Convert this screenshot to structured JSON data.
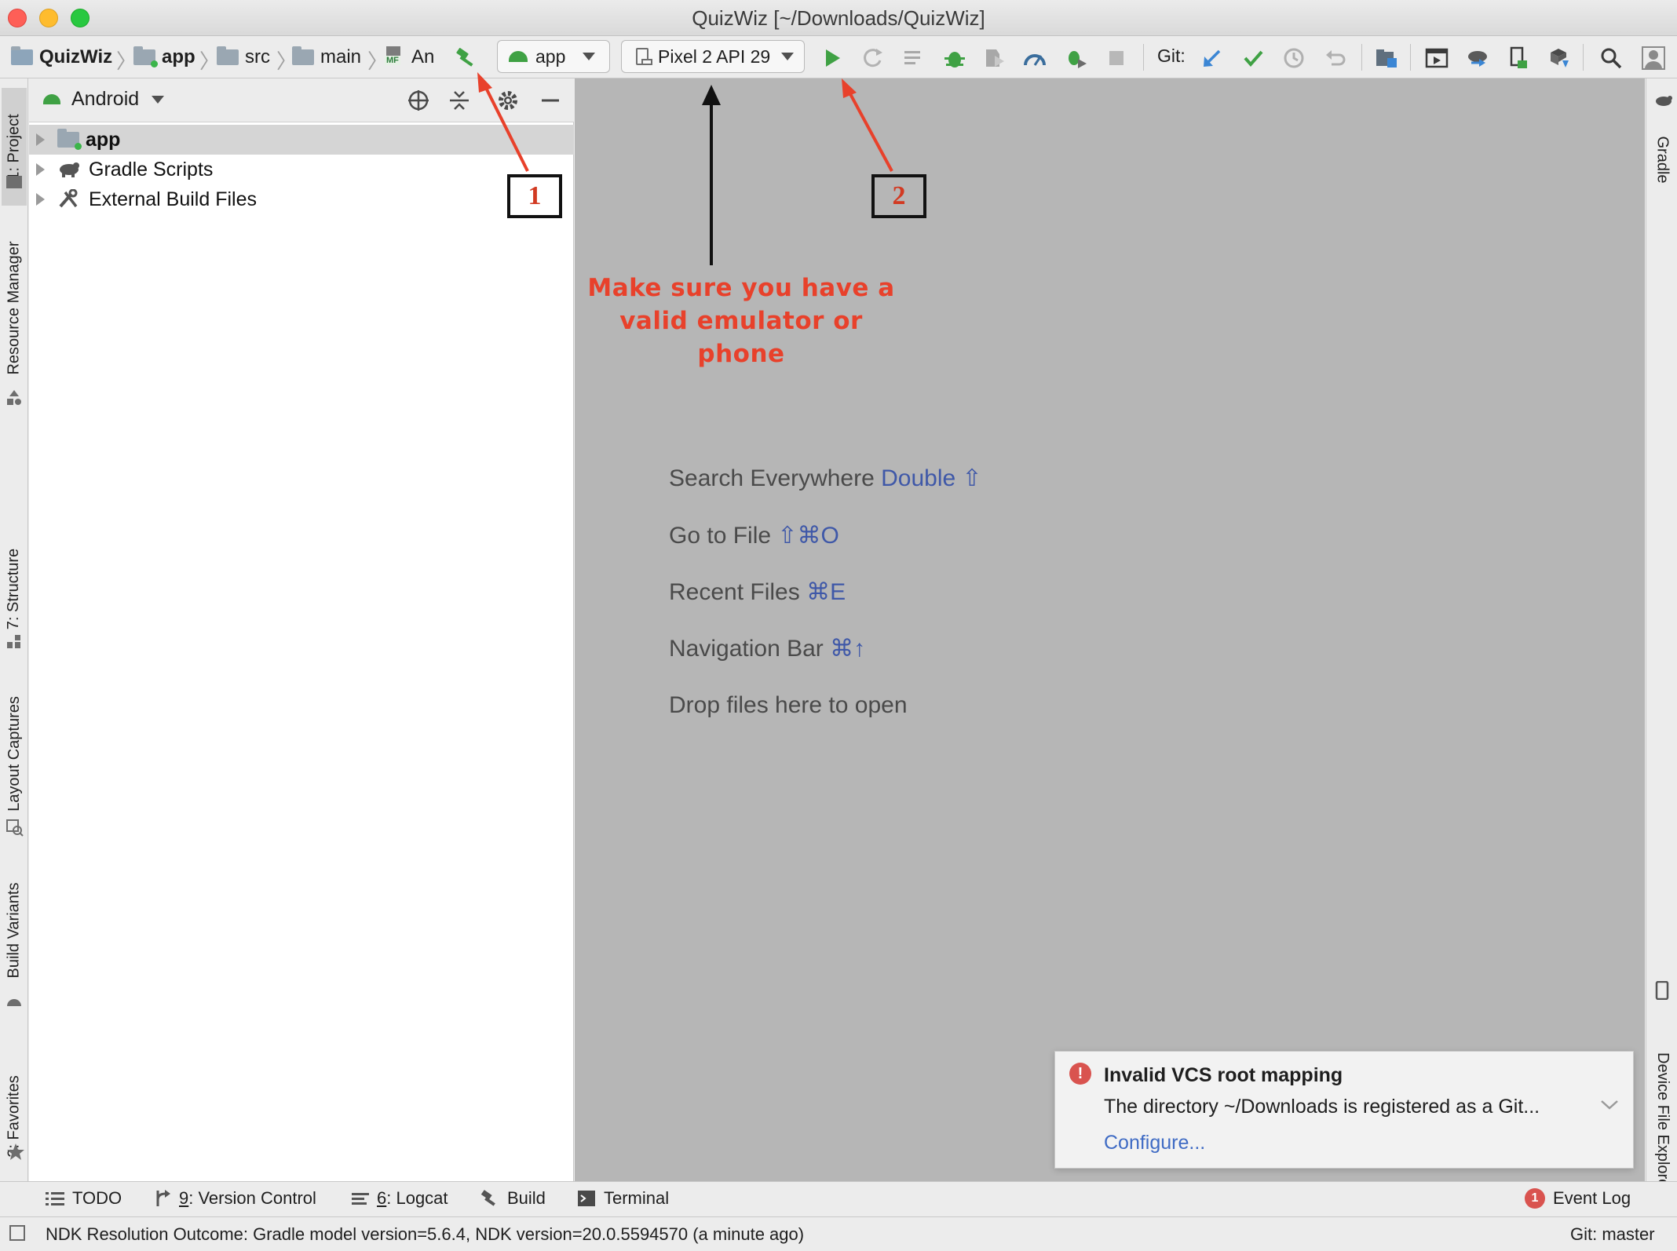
{
  "window": {
    "title": "QuizWiz [~/Downloads/QuizWiz]"
  },
  "breadcrumbs": {
    "project": "QuizWiz",
    "module": "app",
    "src": "src",
    "main": "main",
    "manifest": "An",
    "manifest_badge": "MF"
  },
  "toolbar": {
    "run_config": "app",
    "device": "Pixel 2 API 29",
    "git_label": "Git:"
  },
  "left_tabs": {
    "project": "1: Project",
    "resource_manager": "Resource Manager",
    "structure": "7: Structure",
    "layout_captures": "Layout Captures",
    "build_variants": "Build Variants",
    "favorites": "2: Favorites"
  },
  "right_tabs": {
    "gradle": "Gradle",
    "device_file_explorer": "Device File Explorer"
  },
  "project_panel": {
    "view_mode": "Android",
    "items": [
      {
        "label": "app"
      },
      {
        "label": "Gradle Scripts"
      },
      {
        "label": "External Build Files"
      }
    ]
  },
  "editor_hints": {
    "search": {
      "label": "Search Everywhere",
      "key": "Double ⇧"
    },
    "goto_file": {
      "label": "Go to File",
      "key": "⇧⌘O"
    },
    "recent_files": {
      "label": "Recent Files",
      "key": "⌘E"
    },
    "navigation_bar": {
      "label": "Navigation Bar",
      "key": "⌘↑"
    },
    "drop_files": {
      "label": "Drop files here to open"
    }
  },
  "annotations": {
    "callout_1": "1",
    "callout_2": "2",
    "note_line1": "Make sure you have a",
    "note_line2": "valid emulator or",
    "note_line3": "phone"
  },
  "notification": {
    "title": "Invalid VCS root mapping",
    "body": "The directory ~/Downloads is registered as a Git...",
    "action": "Configure..."
  },
  "bottom_tabs": {
    "todo": "TODO",
    "version_control_num": "9",
    "version_control": ": Version Control",
    "logcat_num": "6",
    "logcat": ": Logcat",
    "build": "Build",
    "terminal": "Terminal",
    "event_log": "Event Log",
    "event_log_count": "1"
  },
  "status_bar": {
    "message": "NDK Resolution Outcome: Gradle model version=5.6.4, NDK version=20.0.5594570 (a minute ago)",
    "git_branch": "Git: master"
  },
  "colors": {
    "annotation_red": "#e8412b",
    "run_green": "#3fa144",
    "link_blue": "#3f58a8",
    "editor_bg": "#b6b6b6"
  }
}
